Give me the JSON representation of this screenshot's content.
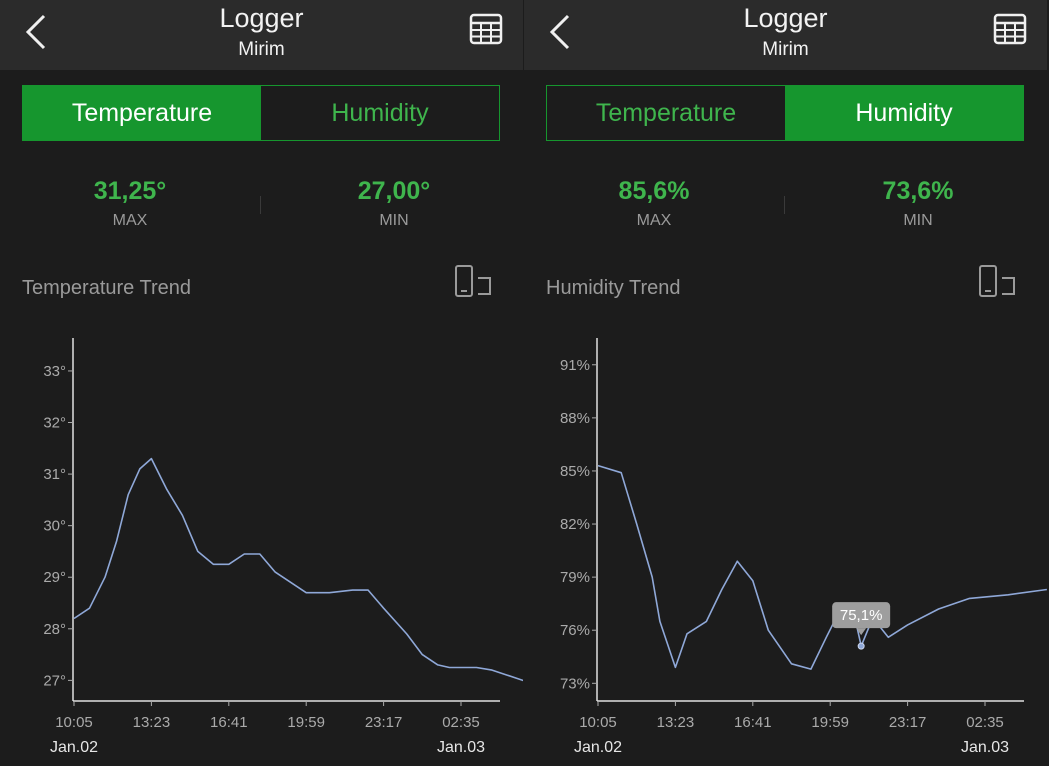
{
  "app": {
    "title": "Logger",
    "subtitle": "Mirim"
  },
  "colors": {
    "accent": "#16962e",
    "accent_text": "#3fb54d",
    "line": "#8fa8d8",
    "background": "#1c1c1c",
    "topbar": "#2b2b2b"
  },
  "icons": {
    "back": "chevron-left-icon",
    "table": "table-icon",
    "rotate": "screen-rotate-icon"
  },
  "left": {
    "tabs": [
      {
        "label": "Temperature",
        "active": true
      },
      {
        "label": "Humidity",
        "active": false
      }
    ],
    "stats": {
      "max_value": "31,25°",
      "max_label": "MAX",
      "min_value": "27,00°",
      "min_label": "MIN"
    },
    "trend_title": "Temperature Trend"
  },
  "right": {
    "tabs": [
      {
        "label": "Temperature",
        "active": false
      },
      {
        "label": "Humidity",
        "active": true
      }
    ],
    "stats": {
      "max_value": "85,6%",
      "max_label": "MAX",
      "min_value": "73,6%",
      "min_label": "MIN"
    },
    "trend_title": "Humidity Trend"
  },
  "chart_data": [
    {
      "type": "line",
      "title": "Temperature Trend",
      "y_unit": "°",
      "ylim": [
        26.6,
        33.6
      ],
      "y_ticks": [
        27,
        28,
        29,
        30,
        31,
        32,
        33
      ],
      "y_tick_labels": [
        "27°",
        "28°",
        "29°",
        "30°",
        "31°",
        "32°",
        "33°"
      ],
      "x_tick_labels": [
        "10:05",
        "13:23",
        "16:41",
        "19:59",
        "23:17",
        "02:35"
      ],
      "date_labels": [
        "Jan.02",
        "Jan.03"
      ],
      "grid": false,
      "series": [
        {
          "x": [
            0,
            0.2,
            0.4,
            0.55,
            0.7,
            0.85,
            1.0,
            1.2,
            1.4,
            1.6,
            1.8,
            2.0,
            2.2,
            2.4,
            2.6,
            3.0,
            3.3,
            3.6,
            3.8,
            4.0,
            4.3,
            4.5,
            4.7,
            4.85,
            5.0,
            5.2,
            5.4,
            5.6,
            5.8,
            6.0
          ],
          "y": [
            28.2,
            28.4,
            29.0,
            29.7,
            30.6,
            31.1,
            31.3,
            30.7,
            30.2,
            29.5,
            29.25,
            29.25,
            29.45,
            29.45,
            29.1,
            28.7,
            28.7,
            28.75,
            28.75,
            28.4,
            27.9,
            27.5,
            27.3,
            27.25,
            27.25,
            27.25,
            27.2,
            27.1,
            27.0,
            27.0
          ]
        }
      ]
    },
    {
      "type": "line",
      "title": "Humidity Trend",
      "y_unit": "%",
      "ylim": [
        72,
        92.4
      ],
      "y_ticks": [
        73,
        76,
        79,
        82,
        85,
        88,
        91
      ],
      "y_tick_labels": [
        "73%",
        "76%",
        "79%",
        "82%",
        "85%",
        "88%",
        "91%"
      ],
      "x_tick_labels": [
        "10:05",
        "13:23",
        "16:41",
        "19:59",
        "23:17",
        "02:35"
      ],
      "date_labels": [
        "Jan.02",
        "Jan.03"
      ],
      "grid": false,
      "tooltip": {
        "label": "75,1%",
        "x": 3.4,
        "y": 75.1
      },
      "series": [
        {
          "x": [
            0,
            0.3,
            0.5,
            0.7,
            0.8,
            1.0,
            1.15,
            1.4,
            1.6,
            1.8,
            2.0,
            2.2,
            2.5,
            2.75,
            2.95,
            3.1,
            3.3,
            3.4,
            3.55,
            3.75,
            4.0,
            4.4,
            4.8,
            5.3,
            5.8
          ],
          "y": [
            85.3,
            84.9,
            82.0,
            79.0,
            76.5,
            73.9,
            75.8,
            76.5,
            78.3,
            79.9,
            78.8,
            76.0,
            74.1,
            73.8,
            75.6,
            76.9,
            77.1,
            75.1,
            76.7,
            75.6,
            76.3,
            77.2,
            77.8,
            78.0,
            78.3
          ]
        }
      ]
    }
  ]
}
